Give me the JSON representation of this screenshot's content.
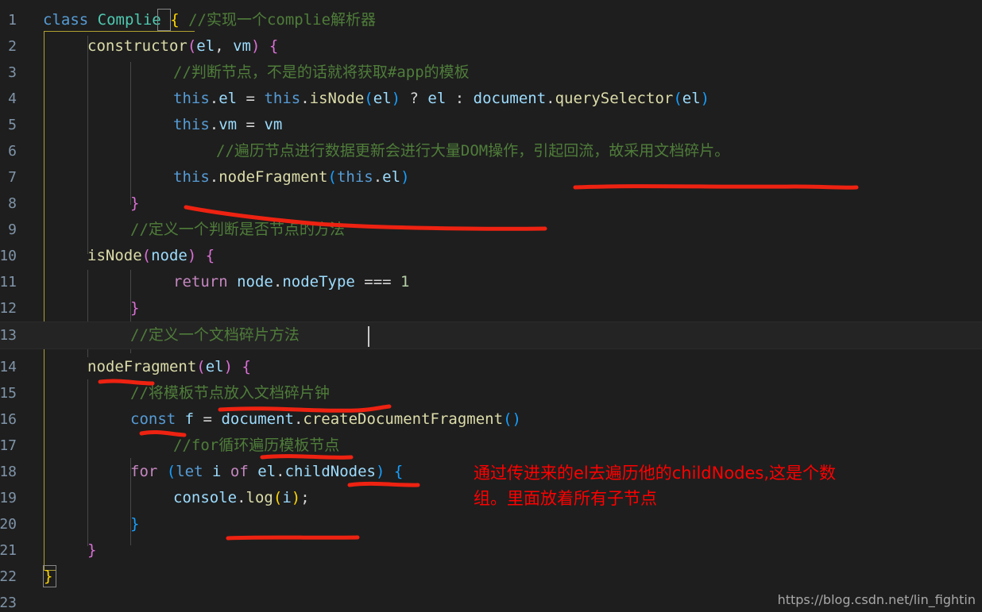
{
  "editor": {
    "theme": "vscode-dark-plus",
    "background": "#1e1e1e",
    "active_line_background": "#242424",
    "gutter_color": "#7f94a8",
    "annotation_color": "#ff0000",
    "watermark": "https://blog.csdn.net/lin_fightin",
    "cursor_line": 13,
    "colors": {
      "keyword": "#569cd6",
      "control_keyword": "#c586c0",
      "type": "#4ec9b0",
      "function": "#dcdcaa",
      "variable": "#9cdcfe",
      "comment": "#4f7d3a",
      "number": "#b5cea8",
      "operator": "#d4d4d4",
      "bracket_yellow": "#ffd700",
      "bracket_pink": "#da70d6",
      "bracket_blue": "#179fff",
      "scope_outline": "#b0a030"
    },
    "line_numbers": [
      "1",
      "2",
      "3",
      "4",
      "5",
      "6",
      "7",
      "8",
      "9",
      "10",
      "11",
      "12",
      "13",
      "14",
      "15",
      "16",
      "17",
      "18",
      "19",
      "20",
      "21",
      "22",
      "23"
    ],
    "lines": [
      {
        "n": "1",
        "text": "class Complie { //实现一个complie解析器"
      },
      {
        "n": "2",
        "text": "    constructor(el, vm) {"
      },
      {
        "n": "3",
        "text": "        //判断节点，不是的话就将获取#app的模板"
      },
      {
        "n": "4",
        "text": "        this.el = this.isNode(el) ? el : document.querySelector(el)"
      },
      {
        "n": "5",
        "text": "        this.vm = vm"
      },
      {
        "n": "6",
        "text": "          //遍历节点进行数据更新会进行大量DOM操作，引起回流，故采用文档碎片。"
      },
      {
        "n": "7",
        "text": "        this.nodeFragment(this.el)"
      },
      {
        "n": "8",
        "text": "    }"
      },
      {
        "n": "9",
        "text": "    //定义一个判断是否节点的方法"
      },
      {
        "n": "10",
        "text": "    isNode(node) {"
      },
      {
        "n": "11",
        "text": "        return node.nodeType === 1"
      },
      {
        "n": "12",
        "text": "    }"
      },
      {
        "n": "13",
        "text": "    //定义一个文档碎片方法"
      },
      {
        "n": "14",
        "text": "    nodeFragment(el) {"
      },
      {
        "n": "15",
        "text": "        //将模板节点放入文档碎片钟"
      },
      {
        "n": "16",
        "text": "        const f = document.createDocumentFragment()"
      },
      {
        "n": "17",
        "text": "        //for循环遍历模板节点"
      },
      {
        "n": "18",
        "text": "        for (let i of el.childNodes) {"
      },
      {
        "n": "19",
        "text": "            console.log(i);"
      },
      {
        "n": "20",
        "text": "        }"
      },
      {
        "n": "21",
        "text": "    }"
      },
      {
        "n": "22",
        "text": "}"
      },
      {
        "n": "23",
        "text": ""
      }
    ],
    "tokens": {
      "l1": {
        "class_kw": "class",
        "name": "Complie",
        "brace": "{",
        "comment": "//实现一个complie解析器"
      },
      "l2": {
        "fn": "constructor",
        "open": "(",
        "a1": "el",
        "comma": ", ",
        "a2": "vm",
        "close": ")",
        "brace": "{"
      },
      "l3": {
        "comment": "//判断节点，不是的话就将获取#app的模板"
      },
      "l4": {
        "this1": "this",
        "dot1": ".",
        "el1": "el",
        "eq": " = ",
        "this2": "this",
        "dot2": ".",
        "fn": "isNode",
        "p1": "(",
        "arg": "el",
        "p2": ")",
        "q": " ? ",
        "r1": "el",
        "colon": " : ",
        "doc": "document",
        "dot3": ".",
        "qs": "querySelector",
        "p3": "(",
        "arg2": "el",
        "p4": ")"
      },
      "l5": {
        "this": "this",
        "dot": ".",
        "vm": "vm",
        "eq": " = ",
        "val": "vm"
      },
      "l6": {
        "comment": "//遍历节点进行数据更新会进行大量DOM操作，引起回流，故采用文档碎片。"
      },
      "l7": {
        "this": "this",
        "dot": ".",
        "fn": "nodeFragment",
        "p1": "(",
        "a1": "this",
        "dot2": ".",
        "a2": "el",
        "p2": ")"
      },
      "l8": {
        "brace": "}"
      },
      "l9": {
        "comment": "//定义一个判断是否节点的方法"
      },
      "l10": {
        "fn": "isNode",
        "p1": "(",
        "arg": "node",
        "p2": ")",
        "brace": "{"
      },
      "l11": {
        "ret": "return",
        "obj": "node",
        "dot": ".",
        "prop": "nodeType",
        "op": " === ",
        "num": "1"
      },
      "l12": {
        "brace": "}"
      },
      "l13": {
        "comment": "//定义一个文档碎片方法"
      },
      "l14": {
        "fn": "nodeFragment",
        "p1": "(",
        "arg": "el",
        "p2": ")",
        "brace": "{"
      },
      "l15": {
        "comment": "//将模板节点放入文档碎片钟"
      },
      "l16": {
        "const": "const",
        "f": "f",
        "eq": " = ",
        "doc": "document",
        "dot": ".",
        "fn": "createDocumentFragment",
        "p1": "(",
        "p2": ")"
      },
      "l17": {
        "comment": "//for循环遍历模板节点"
      },
      "l18": {
        "for": "for",
        "p1": "(",
        "let": "let",
        "i": "i",
        "of": "of",
        "el": "el",
        "dot": ".",
        "prop": "childNodes",
        "p2": ")",
        "brace": "{"
      },
      "l19": {
        "obj": "console",
        "dot": ".",
        "fn": "log",
        "p1": "(",
        "arg": "i",
        "p2": ")",
        "semi": ";"
      },
      "l20": {
        "brace": "}"
      },
      "l21": {
        "brace": "}"
      },
      "l22": {
        "brace": "}"
      }
    }
  },
  "annotations": {
    "red_note": {
      "line1": "通过传进来的el去遍历他的childNodes,这是个数",
      "line2": "组。里面放着所有子节点"
    },
    "underlines": [
      {
        "name": "underline-nodefragment-call",
        "desc": "horizontal stroke under this.nodeFragment(this.el)"
      },
      {
        "name": "underline-closing-brace-8",
        "desc": "long stroke under closing brace line 8"
      },
      {
        "name": "underline-nodefragment-def",
        "desc": "short stroke under nodeFragment(el) line 14"
      },
      {
        "name": "underline-comment-15",
        "desc": "stroke under //将模板节点放入文档碎片钟"
      },
      {
        "name": "underline-const-f",
        "desc": "short stroke under const f"
      },
      {
        "name": "underline-comment-17",
        "desc": "stroke under //for循环遍历模板节点"
      },
      {
        "name": "underline-childnodes",
        "desc": "stroke under el.childNodes"
      },
      {
        "name": "underline-closing-brace-20",
        "desc": "stroke under closing brace line 20"
      }
    ]
  }
}
